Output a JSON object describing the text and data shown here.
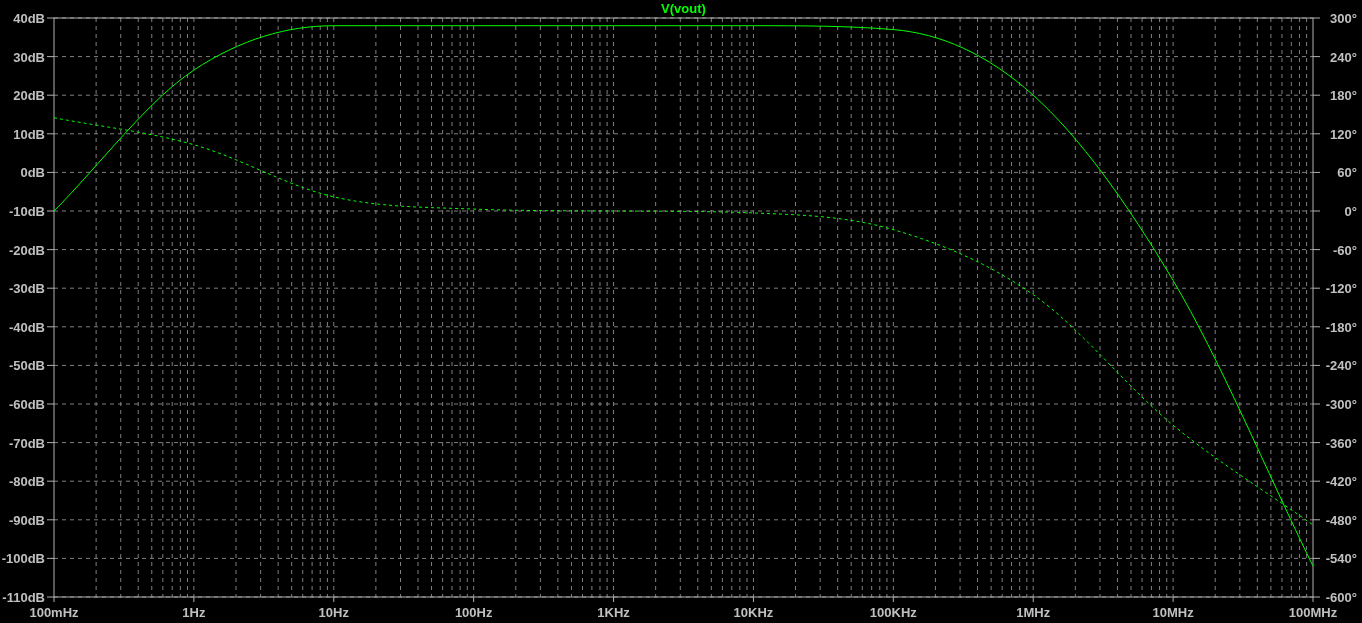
{
  "plot": {
    "chart_data": {
      "type": "line",
      "grid": true,
      "categories": [
        "100mHz",
        "1Hz",
        "10Hz",
        "100Hz",
        "1KHz",
        "10KHz",
        "100KHz",
        "1MHz",
        "10MHz",
        "100MHz"
      ],
      "series": [
        {
          "name": "V(vout)",
          "color": "#00ff00",
          "values": [
            -10,
            26.5,
            38,
            38,
            38,
            38,
            37,
            20,
            -28,
            -102
          ]
        },
        {
          "color": "#00ff00",
          "axis": "y2",
          "line_style": "dashed",
          "values": [
            145,
            103,
            22,
            3,
            0,
            -3,
            -29,
            -130,
            -333,
            -488
          ]
        }
      ],
      "ylim": [
        -110,
        40
      ],
      "yticks": [
        {
          "value": 40,
          "label": "40dB"
        },
        {
          "value": 30,
          "label": "30dB"
        },
        {
          "value": 20,
          "label": "20dB"
        },
        {
          "value": 10,
          "label": "10dB"
        },
        {
          "value": 0,
          "label": "0dB"
        },
        {
          "value": -10,
          "label": "-10dB"
        },
        {
          "value": -20,
          "label": "-20dB"
        },
        {
          "value": -30,
          "label": "-30dB"
        },
        {
          "value": -40,
          "label": "-40dB"
        },
        {
          "value": -50,
          "label": "-50dB"
        },
        {
          "value": -60,
          "label": "-60dB"
        },
        {
          "value": -70,
          "label": "-70dB"
        },
        {
          "value": -80,
          "label": "-80dB"
        },
        {
          "value": -90,
          "label": "-90dB"
        },
        {
          "value": -100,
          "label": "-100dB"
        },
        {
          "value": -110,
          "label": "-110dB"
        }
      ],
      "y2lim": [
        -600,
        300
      ],
      "y2ticks": [
        {
          "value": 300,
          "label": "300°"
        },
        {
          "value": 240,
          "label": "240°"
        },
        {
          "value": 180,
          "label": "180°"
        },
        {
          "value": 120,
          "label": "120°"
        },
        {
          "value": 60,
          "label": "60°"
        },
        {
          "value": 0,
          "label": "0°"
        },
        {
          "value": -60,
          "label": "-60°"
        },
        {
          "value": -120,
          "label": "-120°"
        },
        {
          "value": -180,
          "label": "-180°"
        },
        {
          "value": -240,
          "label": "-240°"
        },
        {
          "value": -300,
          "label": "-300°"
        },
        {
          "value": -360,
          "label": "-360°"
        },
        {
          "value": -420,
          "label": "-420°"
        },
        {
          "value": -480,
          "label": "-480°"
        },
        {
          "value": -540,
          "label": "-540°"
        },
        {
          "value": -600,
          "label": "-600°"
        }
      ]
    }
  }
}
